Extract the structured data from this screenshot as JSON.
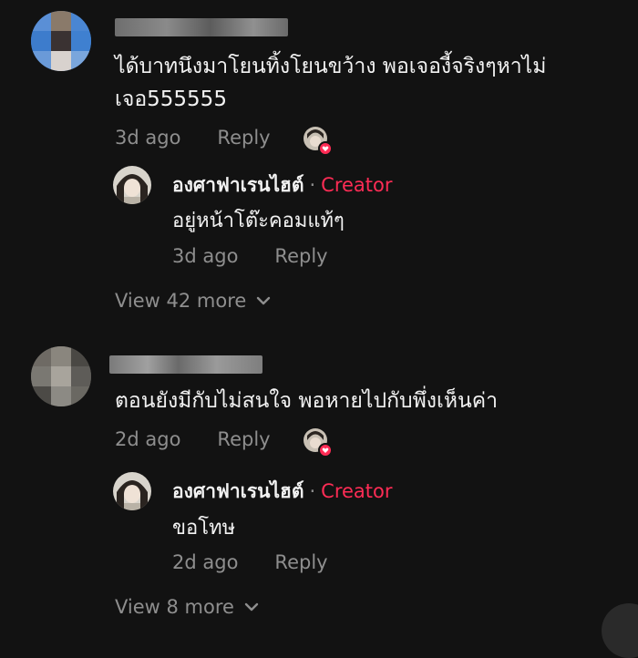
{
  "comments": [
    {
      "text_lines": [
        "ได้บาทนึงมาโยนทิ้งโยนขว้าง พอเจองี้จริงๆหาไม่",
        "เจอ555555"
      ],
      "time": "3d ago",
      "reply_label": "Reply",
      "reply": {
        "author": "องศาฟาเรนไฮต์",
        "separator": "·",
        "badge": "Creator",
        "text": "อยู่หน้าโต๊ะคอมแท้ๆ",
        "time": "3d ago",
        "reply_label": "Reply"
      },
      "view_more": "View 42 more"
    },
    {
      "text_lines": [
        "ตอนยังมีกับไม่สนใจ พอหายไปกับพึ่งเห็นค่า"
      ],
      "time": "2d ago",
      "reply_label": "Reply",
      "reply": {
        "author": "องศาฟาเรนไฮต์",
        "separator": "·",
        "badge": "Creator",
        "text": "ขอโทษ",
        "time": "2d ago",
        "reply_label": "Reply"
      },
      "view_more": "View 8 more"
    }
  ],
  "colors": {
    "background": "#121212",
    "text": "#f2f2f2",
    "muted": "#8e8e8e",
    "creator_badge": "#fe2c55"
  }
}
